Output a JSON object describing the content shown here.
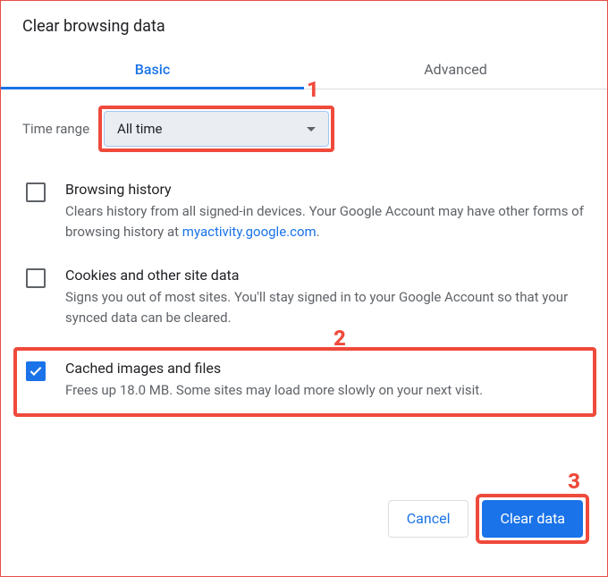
{
  "title": "Clear browsing data",
  "tabs": {
    "basic": "Basic",
    "advanced": "Advanced"
  },
  "timeRange": {
    "label": "Time range",
    "selected": "All time"
  },
  "options": {
    "browsing": {
      "title": "Browsing history",
      "desc_pre": "Clears history from all signed-in devices. Your Google Account may have other forms of browsing history at ",
      "link": "myactivity.google.com",
      "desc_post": "."
    },
    "cookies": {
      "title": "Cookies and other site data",
      "desc": "Signs you out of most sites. You'll stay signed in to your Google Account so that your synced data can be cleared."
    },
    "cache": {
      "title": "Cached images and files",
      "desc": "Frees up 18.0 MB. Some sites may load more slowly on your next visit."
    }
  },
  "buttons": {
    "cancel": "Cancel",
    "clear": "Clear data"
  },
  "callouts": {
    "c1": "1",
    "c2": "2",
    "c3": "3"
  }
}
